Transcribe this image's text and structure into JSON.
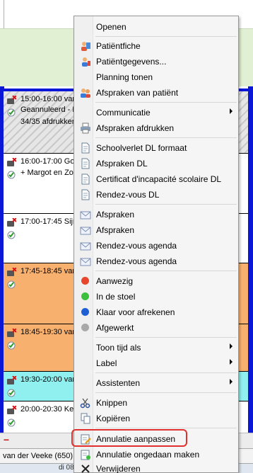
{
  "agenda": {
    "appointments": [
      {
        "time": "15:00-16:00 van",
        "line2": "Geannuleerd - Ni",
        "line3": "34/35 afdrukken"
      },
      {
        "time": "16:00-17:00 Gou",
        "line2": "+ Margot en Zoe",
        "line3": ""
      },
      {
        "time": "17:00-17:45 Sijm",
        "line2": "",
        "line3": ""
      },
      {
        "time": "17:45-18:45 van",
        "line2": "",
        "line3": ""
      },
      {
        "time": "18:45-19:30 van",
        "line2": "",
        "line3": ""
      },
      {
        "time": "19:30-20:00 van",
        "line2": "",
        "line3": ""
      },
      {
        "time": "20:00-20:30 Kers",
        "line2": "",
        "line3": ""
      }
    ],
    "footer_tab": "van der Veeke (650)",
    "footer_date": "di 08"
  },
  "menu": {
    "open": "Openen",
    "patientfiche": "Patiëntfiche",
    "patientgegevens": "Patiëntgegevens...",
    "planning": "Planning tonen",
    "afspraken_patient": "Afspraken van patiënt",
    "communicatie": "Communicatie",
    "afspraken_afdrukken": "Afspraken afdrukken",
    "schoolverlet": "Schoolverlet DL formaat",
    "afspraken_dl": "Afspraken DL",
    "certificat": "Certificat d'incapacité scolaire DL",
    "rendezvous_dl": "Rendez-vous DL",
    "afspraken_1": "Afspraken",
    "afspraken_2": "Afspraken",
    "rendezvous_agenda_1": "Rendez-vous agenda",
    "rendezvous_agenda_2": "Rendez-vous agenda",
    "aanwezig": "Aanwezig",
    "in_de_stoel": "In de stoel",
    "klaar": "Klaar voor afrekenen",
    "afgewerkt": "Afgewerkt",
    "toon_tijd_als": "Toon tijd als",
    "label": "Label",
    "assistenten": "Assistenten",
    "knippen": "Knippen",
    "kopieren": "Kopiëren",
    "annulatie_aanpassen": "Annulatie aanpassen",
    "annulatie_ongedaan": "Annulatie ongedaan maken",
    "verwijderen": "Verwijderen"
  },
  "colors": {
    "aanwezig": "#e8452c",
    "in_de_stoel": "#3cbf3c",
    "klaar": "#1f5fd6",
    "afgewerkt": "#a9a9a9",
    "highlight": "#e0312f"
  }
}
